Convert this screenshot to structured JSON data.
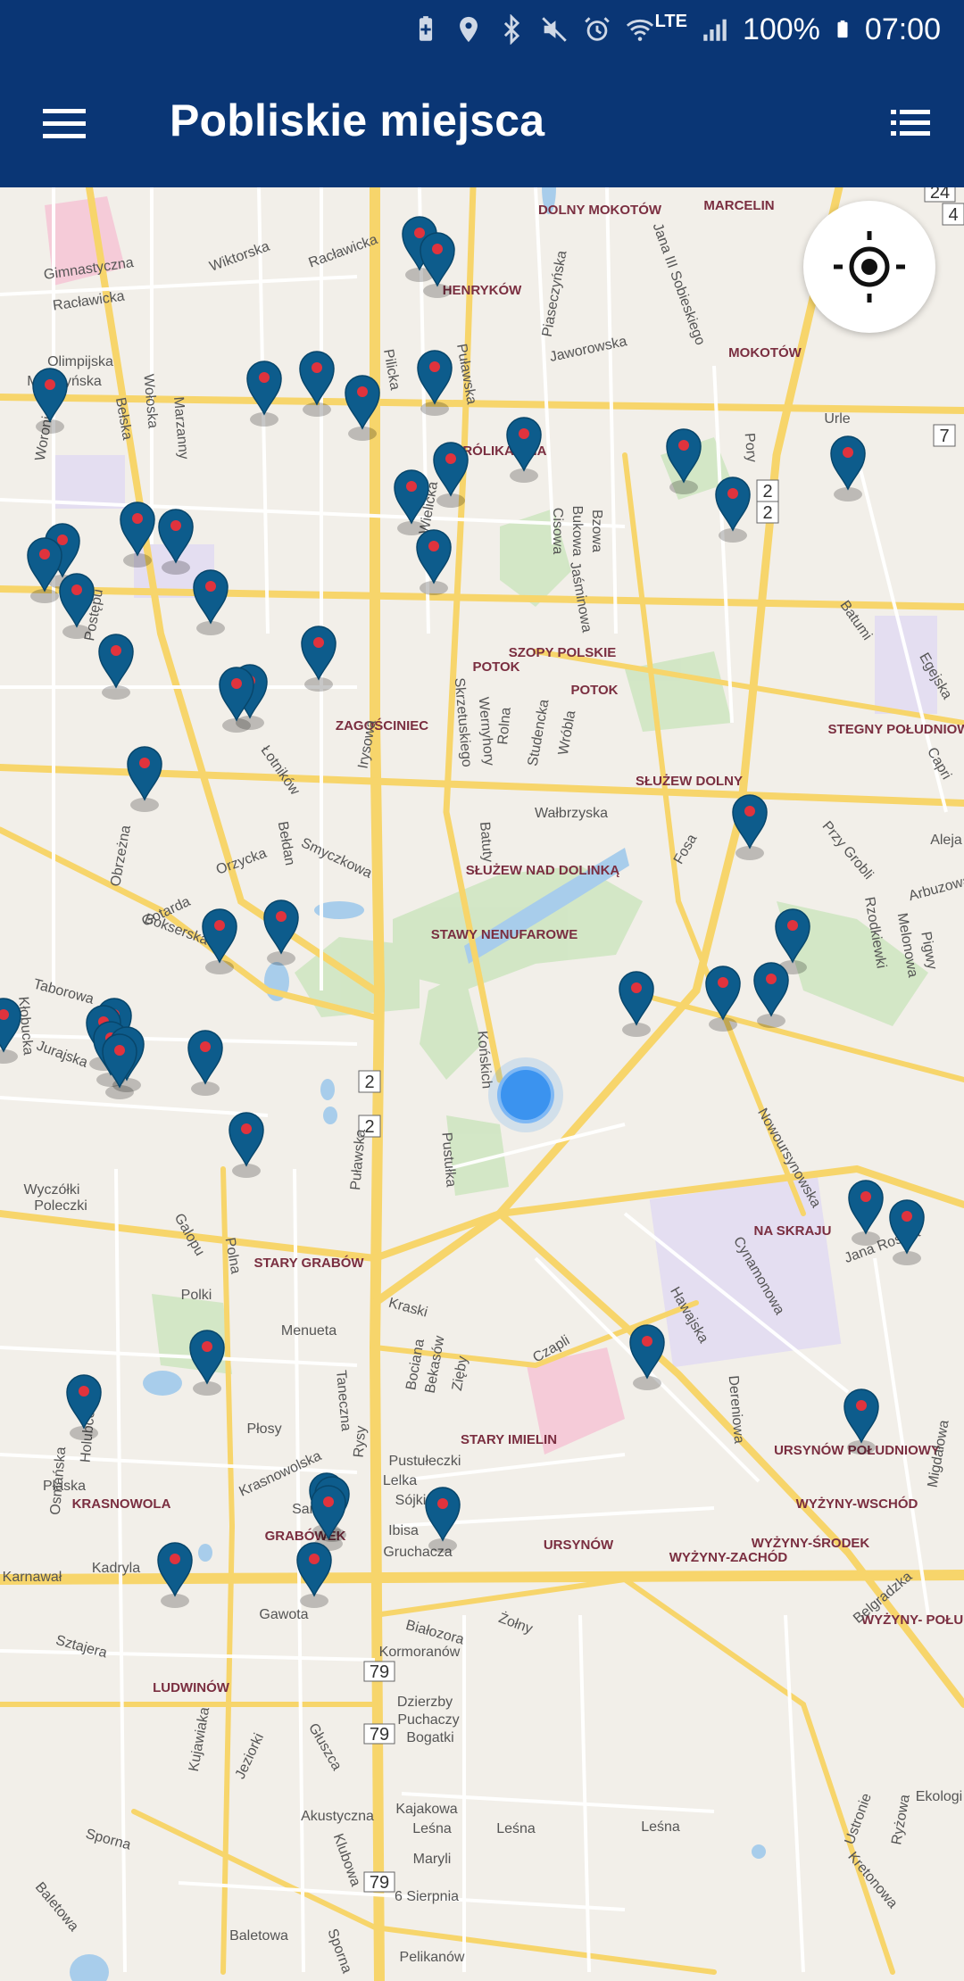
{
  "status_bar": {
    "battery": "100%",
    "time": "07:00",
    "network": "LTE",
    "icons": [
      "battery-saver-icon",
      "location-icon",
      "bluetooth-icon",
      "mute-icon",
      "alarm-icon",
      "wifi-icon",
      "signal-icon",
      "battery-icon"
    ]
  },
  "app_bar": {
    "title": "Pobliskie miejsca",
    "menu_icon": "hamburger-menu-icon",
    "list_icon": "list-view-icon",
    "background": "#0a3675"
  },
  "map": {
    "locate_icon": "my-location-icon",
    "pin_color": "#0d5c8c",
    "pin_dot_color": "#e0333d",
    "user_dot_color": "#3b93ef",
    "district_labels": [
      "DOLNY MOKOTÓW",
      "MARCELIN",
      "HENRYKÓW",
      "MOKOTÓW",
      "KRÓLIKARNIA",
      "SZOPY POLSKIE",
      "POTOK",
      "POTOK",
      "STEGNY POŁUDNIOWE",
      "ZAGOŚCINIEC",
      "SŁUŻEW DOLNY",
      "SŁUŻEW NAD DOLINKĄ",
      "STAWY NENUFAROWE",
      "NA SKRAJU",
      "STARY GRABÓW",
      "STARY IMIELIN",
      "URSYNÓW POŁUDNIOWY",
      "WYŻYNY-WSCHÓD",
      "WYŻYNY-ŚRODEK",
      "KRASNOWOLA",
      "GRABÓWEK",
      "URSYNÓW",
      "WYŻYNY-ZACHÓD",
      "WYŻYNY- POŁUDNIE",
      "LUDWINÓW"
    ],
    "street_labels": [
      "Gimnastyczna",
      "Racławicka",
      "Wiktorska",
      "Racławicka",
      "Olimpijska",
      "Miączyńska",
      "Woronicza",
      "Marzanny",
      "Wołoska",
      "Bełska",
      "Piaseczyńska",
      "Jaworowska",
      "Puławska",
      "Pilicka",
      "Wielicka",
      "Bzowa",
      "Bukowa",
      "Cisowa",
      "Jaśminowa",
      "Jana III Sobieskiego",
      "Pory",
      "Urle",
      "Batumi",
      "Egejska",
      "Capri",
      "Postępu",
      "Skrzetuskiego",
      "Wernyhory",
      "Rolna",
      "Studencka",
      "Wróbla",
      "Łotników",
      "Irysowa",
      "Bełdan",
      "Smyczkowa",
      "Orzycka",
      "Gotarda",
      "Obrzeżna",
      "Wałbrzyska",
      "Batuty",
      "Fosa",
      "Przy Grobli",
      "Arbuzowa",
      "Aleja",
      "Rzodkiewki",
      "Melonowa",
      "Pigwy",
      "Bokserska",
      "Taborowa",
      "Kłobucka",
      "Jurajska",
      "Puławska",
      "Końskich",
      "Pustułka",
      "Nowoursynowska",
      "Cynamonowa",
      "Jana Rosoła",
      "Wyczółki",
      "Poleczki",
      "Galopu",
      "Polna",
      "Polki",
      "Menueta",
      "Taneczna",
      "Kraski",
      "Bociana",
      "Bekasów",
      "Czapli",
      "Zięby",
      "Hawajska",
      "Dereniowa",
      "Migdałowa",
      "Płaska",
      "Holubcowa",
      "Osmańska",
      "Płosy",
      "Krasnowolska",
      "Samby",
      "Rysy",
      "Pustułeczki",
      "Lelka",
      "Sójki",
      "Ibisa",
      "Gruchacza",
      "Belgradzka",
      "Karnawał",
      "Kadryla",
      "Gawota",
      "Białozora",
      "Żołny",
      "Kormoranów",
      "Dzierzby",
      "Puchaczy",
      "Bogatki",
      "Sztajera",
      "Jeziorki",
      "Kujawiaka",
      "Głuszca",
      "Kajakowa",
      "Leśna",
      "Leśna",
      "Leśna",
      "Sporna",
      "Akustyczna",
      "Maryli",
      "Klubowa",
      "6 Sierpnia",
      "Baletowa",
      "Baletowa",
      "Pelikanów",
      "Sporna",
      "Ustronie",
      "Kretonowa",
      "Ekologi",
      "Ryżowa"
    ],
    "road_shields": [
      "2",
      "2",
      "2",
      "2",
      "7",
      "79",
      "79",
      "79",
      "4",
      "24"
    ]
  }
}
